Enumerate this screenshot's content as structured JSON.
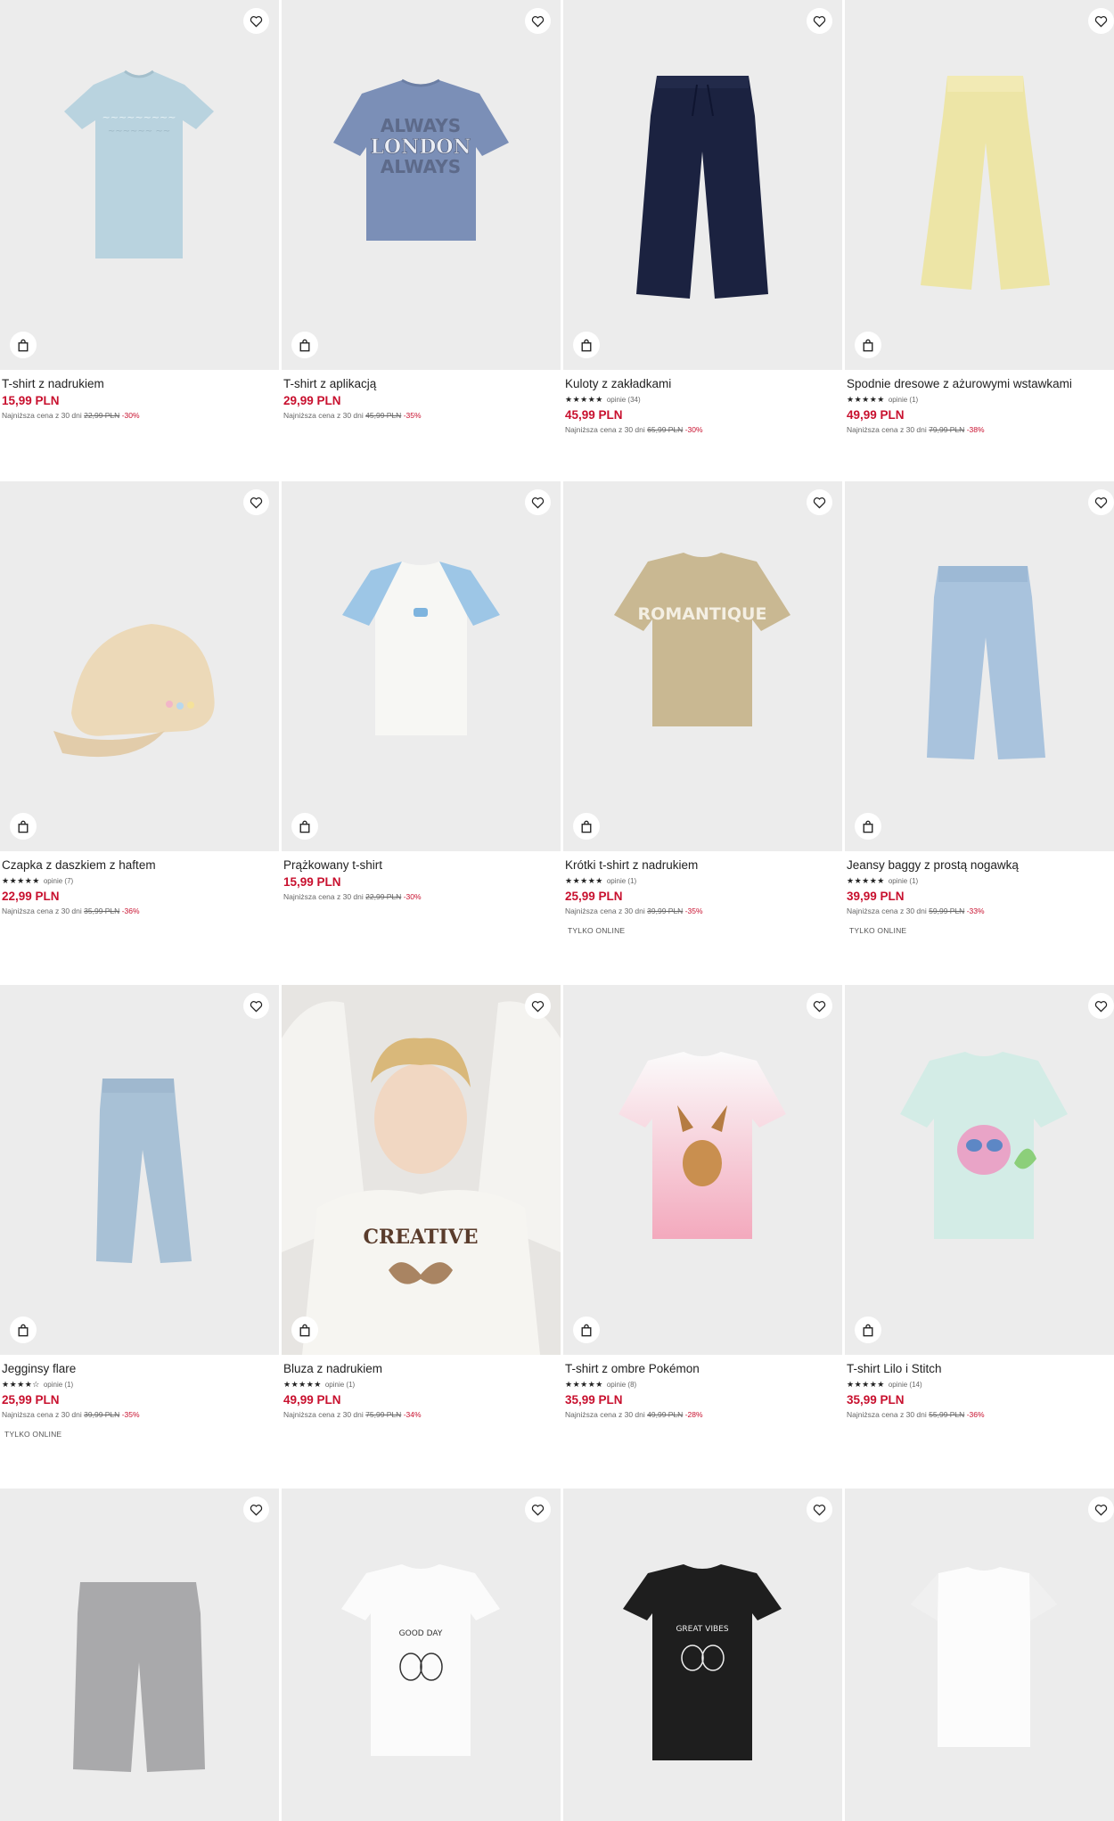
{
  "icons": {
    "favorite": "heart-outline-icon",
    "cart": "shopping-bag-icon"
  },
  "colors": {
    "price": "#c8102e",
    "discount": "#c8102e",
    "background": "#ececec"
  },
  "rows": [
    {
      "products": [
        {
          "name": "T-shirt z nadrukiem",
          "price": "15,99 PLN",
          "lowest_prefix": "Najniższa cena z 30 dni",
          "old_price": "22,99 PLN",
          "discount": "-30%",
          "rating": null,
          "online": null
        },
        {
          "name": "T-shirt z aplikacją",
          "price": "29,99 PLN",
          "lowest_prefix": "Najniższa cena z 30 dni",
          "old_price": "45,99 PLN",
          "discount": "-35%",
          "rating": null,
          "online": null
        },
        {
          "name": "Kuloty z zakładkami",
          "price": "45,99 PLN",
          "lowest_prefix": "Najniższa cena z 30 dni",
          "old_price": "65,99 PLN",
          "discount": "-30%",
          "rating": {
            "stars": "★★★★★",
            "reviews": "opinie (34)"
          },
          "online": null
        },
        {
          "name": "Spodnie dresowe z ażurowymi wstawkami",
          "price": "49,99 PLN",
          "lowest_prefix": "Najniższa cena z 30 dni",
          "old_price": "79,99 PLN",
          "discount": "-38%",
          "rating": {
            "stars": "★★★★★",
            "reviews": "opinie (1)"
          },
          "online": null
        }
      ]
    },
    {
      "products": [
        {
          "name": "Czapka z daszkiem z haftem",
          "price": "22,99 PLN",
          "lowest_prefix": "Najniższa cena z 30 dni",
          "old_price": "35,99 PLN",
          "discount": "-36%",
          "rating": {
            "stars": "★★★★★",
            "reviews": "opinie (7)"
          },
          "online": null
        },
        {
          "name": "Prążkowany t-shirt",
          "price": "15,99 PLN",
          "lowest_prefix": "Najniższa cena z 30 dni",
          "old_price": "22,99 PLN",
          "discount": "-30%",
          "rating": null,
          "online": null
        },
        {
          "name": "Krótki t-shirt z nadrukiem",
          "price": "25,99 PLN",
          "lowest_prefix": "Najniższa cena z 30 dni",
          "old_price": "39,99 PLN",
          "discount": "-35%",
          "rating": {
            "stars": "★★★★★",
            "reviews": "opinie (1)"
          },
          "online": "TYLKO ONLINE"
        },
        {
          "name": "Jeansy baggy z prostą nogawką",
          "price": "39,99 PLN",
          "lowest_prefix": "Najniższa cena z 30 dni",
          "old_price": "59,99 PLN",
          "discount": "-33%",
          "rating": {
            "stars": "★★★★★",
            "reviews": "opinie (1)"
          },
          "online": "TYLKO ONLINE"
        }
      ]
    },
    {
      "products": [
        {
          "name": "Jegginsy flare",
          "price": "25,99 PLN",
          "lowest_prefix": "Najniższa cena z 30 dni",
          "old_price": "39,99 PLN",
          "discount": "-35%",
          "rating": {
            "stars": "★★★★☆",
            "reviews": "opinie (1)"
          },
          "online": "TYLKO ONLINE"
        },
        {
          "name": "Bluza z nadrukiem",
          "price": "49,99 PLN",
          "lowest_prefix": "Najniższa cena z 30 dni",
          "old_price": "75,99 PLN",
          "discount": "-34%",
          "rating": {
            "stars": "★★★★★",
            "reviews": "opinie (1)"
          },
          "online": null
        },
        {
          "name": "T-shirt z ombre Pokémon",
          "price": "35,99 PLN",
          "lowest_prefix": "Najniższa cena z 30 dni",
          "old_price": "49,99 PLN",
          "discount": "-28%",
          "rating": {
            "stars": "★★★★★",
            "reviews": "opinie (8)"
          },
          "online": null
        },
        {
          "name": "T-shirt Lilo i Stitch",
          "price": "35,99 PLN",
          "lowest_prefix": "Najniższa cena z 30 dni",
          "old_price": "55,99 PLN",
          "discount": "-36%",
          "rating": {
            "stars": "★★★★★",
            "reviews": "opinie (14)"
          },
          "online": null
        }
      ]
    },
    {
      "products": [
        {
          "image_only": true
        },
        {
          "image_only": true
        },
        {
          "image_only": true
        },
        {
          "image_only": true
        }
      ]
    }
  ],
  "garment_texts": {
    "london_top": "ALWAYS",
    "london_mid": "LONDON",
    "london_bot": "ALWAYS",
    "romantique": "ROMANTIQUE",
    "creative": "CREATIVE",
    "good_day": "GOOD DAY",
    "great_vibes": "GREAT VIBES"
  }
}
